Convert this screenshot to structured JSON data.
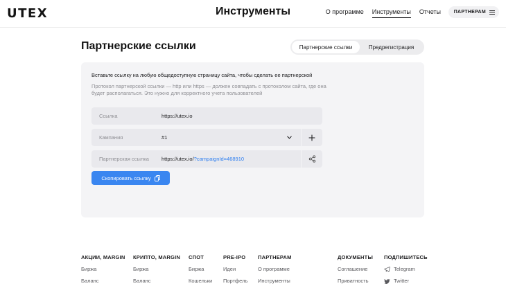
{
  "header": {
    "logo": "UTEX",
    "title": "Инструменты",
    "nav": [
      "О программе",
      "Инструменты",
      "Отчеты"
    ],
    "partner_button": "ПАРТНЕРАМ"
  },
  "section": {
    "title": "Партнерские ссылки",
    "tabs": [
      "Партнерские ссылки",
      "Предрегистрация"
    ]
  },
  "card": {
    "heading": "Вставьте ссылку на любую общедоступную страницу сайта, чтобы сделать ее партнерской",
    "description": "Протокол партнерской ссылки — http или https — должен совпадать с протоколом сайта, где она будет располагаться. Это нужно для корректного учета пользователей",
    "link": {
      "label": "Ссылка",
      "value": "https://utex.io"
    },
    "campaign": {
      "label": "Кампания",
      "value": "#1"
    },
    "partner_link": {
      "label": "Партнерская ссылка",
      "base": "https://utex.io/",
      "query": "?campaignId=468910"
    },
    "copy_button": "Скопировать ссылку"
  },
  "footer": {
    "columns": [
      {
        "title": "АКЦИИ, MARGIN",
        "items": [
          "Биржа",
          "Баланс"
        ]
      },
      {
        "title": "КРИПТО, MARGIN",
        "items": [
          "Биржа",
          "Баланс"
        ]
      },
      {
        "title": "СПОТ",
        "items": [
          "Биржа",
          "Кошельки"
        ]
      },
      {
        "title": "PRE-IPO",
        "items": [
          "Идеи",
          "Портфель"
        ]
      },
      {
        "title": "ПАРТНЕРАМ",
        "items": [
          "О программе",
          "Инструменты"
        ]
      },
      {
        "title": "ДОКУМЕНТЫ",
        "items": [
          "Соглашение",
          "Приватность"
        ]
      },
      {
        "title": "ПОДПИШИТЕСЬ",
        "items": [
          "Telegram",
          "Twitter"
        ]
      }
    ]
  },
  "colors": {
    "accent": "#3a86f0",
    "link": "#2f7ff0",
    "card_bg": "#f4f4f6"
  }
}
